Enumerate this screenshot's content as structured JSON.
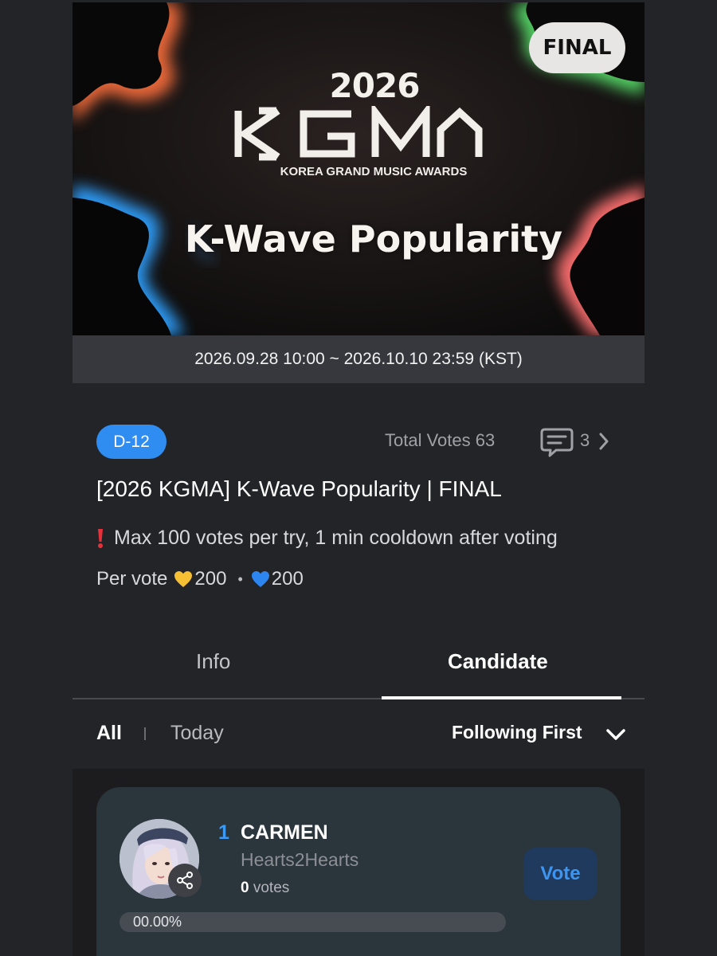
{
  "banner": {
    "badge": "FINAL",
    "year": "2026",
    "logo_text": "KGMA",
    "subtitle": "KOREA GRAND MUSIC AWARDS",
    "title": "K-Wave Popularity"
  },
  "event": {
    "period": "2026.09.28 10:00 ~ 2026.10.10 23:59 (KST)",
    "dday": "D-12",
    "total_votes_label": "Total Votes",
    "total_votes_value": "63",
    "comment_count": "3",
    "title": "[2026 KGMA] K-Wave Popularity | FINAL",
    "notice": "Max 100 votes per try, 1 min cooldown after voting",
    "per_vote_label": "Per vote",
    "gold_heart_cost": "200",
    "blue_heart_cost": "200",
    "separator": "•"
  },
  "tabs": [
    {
      "label": "Info",
      "active": false
    },
    {
      "label": "Candidate",
      "active": true
    }
  ],
  "filters": {
    "all": "All",
    "today": "Today",
    "sort": "Following First"
  },
  "candidates": [
    {
      "rank": "1",
      "name": "CARMEN",
      "group": "Hearts2Hearts",
      "votes_count": "0",
      "votes_label": "votes",
      "vote_button": "Vote",
      "percent_label": "00.00%",
      "percent_value": 0.0
    }
  ],
  "colors": {
    "accent_blue": "#2f8cf0",
    "background": "#232428",
    "card": "#2b353c"
  },
  "icons": [
    "comment-icon",
    "chevron-right-icon",
    "exclamation-icon",
    "gold-heart-icon",
    "blue-heart-icon",
    "chevron-down-icon",
    "share-icon"
  ]
}
